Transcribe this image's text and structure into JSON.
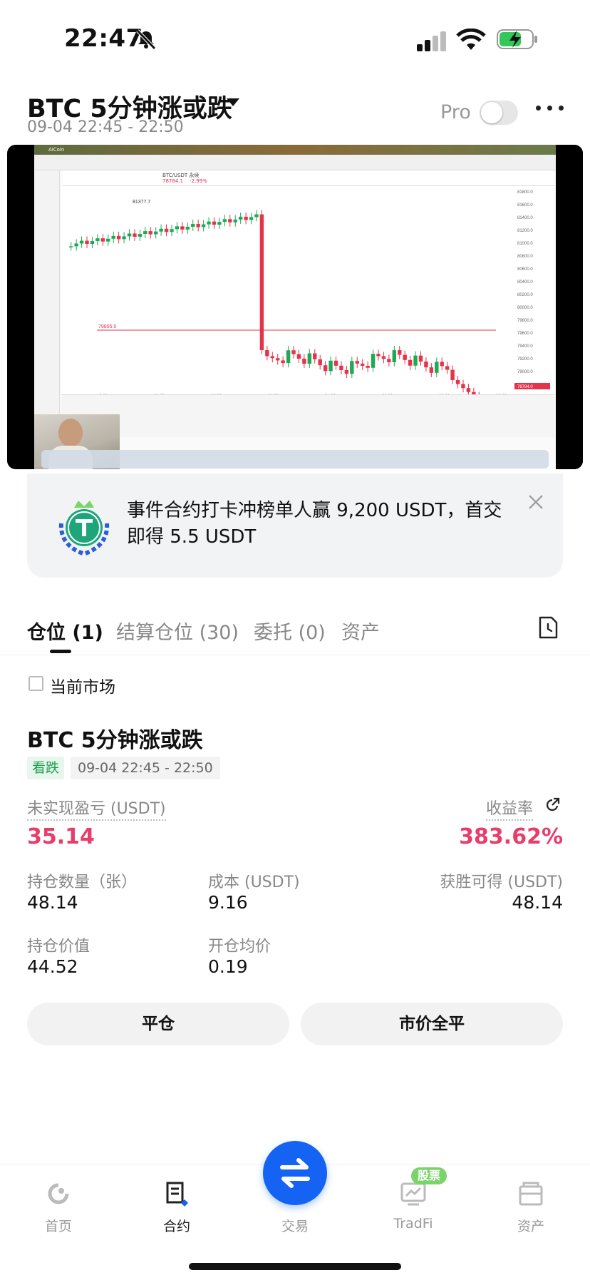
{
  "status": {
    "time": "22:47"
  },
  "header": {
    "title": "BTC 5分钟涨或跌",
    "subtitle": "09-04 22:45 - 22:50",
    "pro_label": "Pro"
  },
  "promo": {
    "text": "事件合约打卡冲榜单人赢 9,200 USDT，首交即得 5.5 USDT"
  },
  "tabs": [
    {
      "label": "仓位 (1)"
    },
    {
      "label": "结算仓位 (30)"
    },
    {
      "label": "委托 (0)"
    },
    {
      "label": "资产"
    }
  ],
  "filter": {
    "current_market_label": "当前市场"
  },
  "position": {
    "title": "BTC 5分钟涨或跌",
    "side_badge": "看跌",
    "period": "09-04 22:45 - 22:50",
    "unrealized_label": "未实现盈亏 (USDT)",
    "unrealized_value": "35.14",
    "roi_label": "收益率",
    "roi_value": "383.62%",
    "qty_label": "持仓数量（张）",
    "qty_value": "48.14",
    "cost_label": "成本 (USDT)",
    "cost_value": "9.16",
    "win_label": "获胜可得 (USDT)",
    "win_value": "48.14",
    "value_label": "持仓价值",
    "value_value": "44.52",
    "avg_label": "开仓均价",
    "avg_value": "0.19",
    "close_button": "平仓",
    "close_all_button": "市价全平"
  },
  "video": {
    "app_name": "AiCoin",
    "pair": "BTC/USDT 永续",
    "price": "78784.1",
    "change": "-2.99%",
    "high_label": "81377.7",
    "line_label": "79805.0",
    "last_label": "78784.0",
    "xticks": [
      "19:00",
      "20:00",
      "20:30",
      "21:00",
      "21:30",
      "22:00",
      "22:30",
      "23:00"
    ],
    "yticks": [
      "81800.0",
      "81600.0",
      "81400.0",
      "81200.0",
      "81000.0",
      "80800.0",
      "80600.0",
      "80400.0",
      "80200.0",
      "80000.0",
      "79800.0",
      "79600.0",
      "79400.0",
      "79200.0",
      "79000.0"
    ],
    "up_color": "#1fa855",
    "down_color": "#e5334b"
  },
  "nav": [
    {
      "label": "首页",
      "icon": "home-icon"
    },
    {
      "label": "合约",
      "icon": "contract-icon"
    },
    {
      "label": "交易",
      "icon": "swap-icon"
    },
    {
      "label": "TradFi",
      "icon": "chart-icon",
      "badge": "股票"
    },
    {
      "label": "资产",
      "icon": "wallet-icon"
    }
  ],
  "colors": {
    "accent": "#1463f3",
    "loss_red": "#e83d6a",
    "bear_green": "#1e9e4e"
  }
}
